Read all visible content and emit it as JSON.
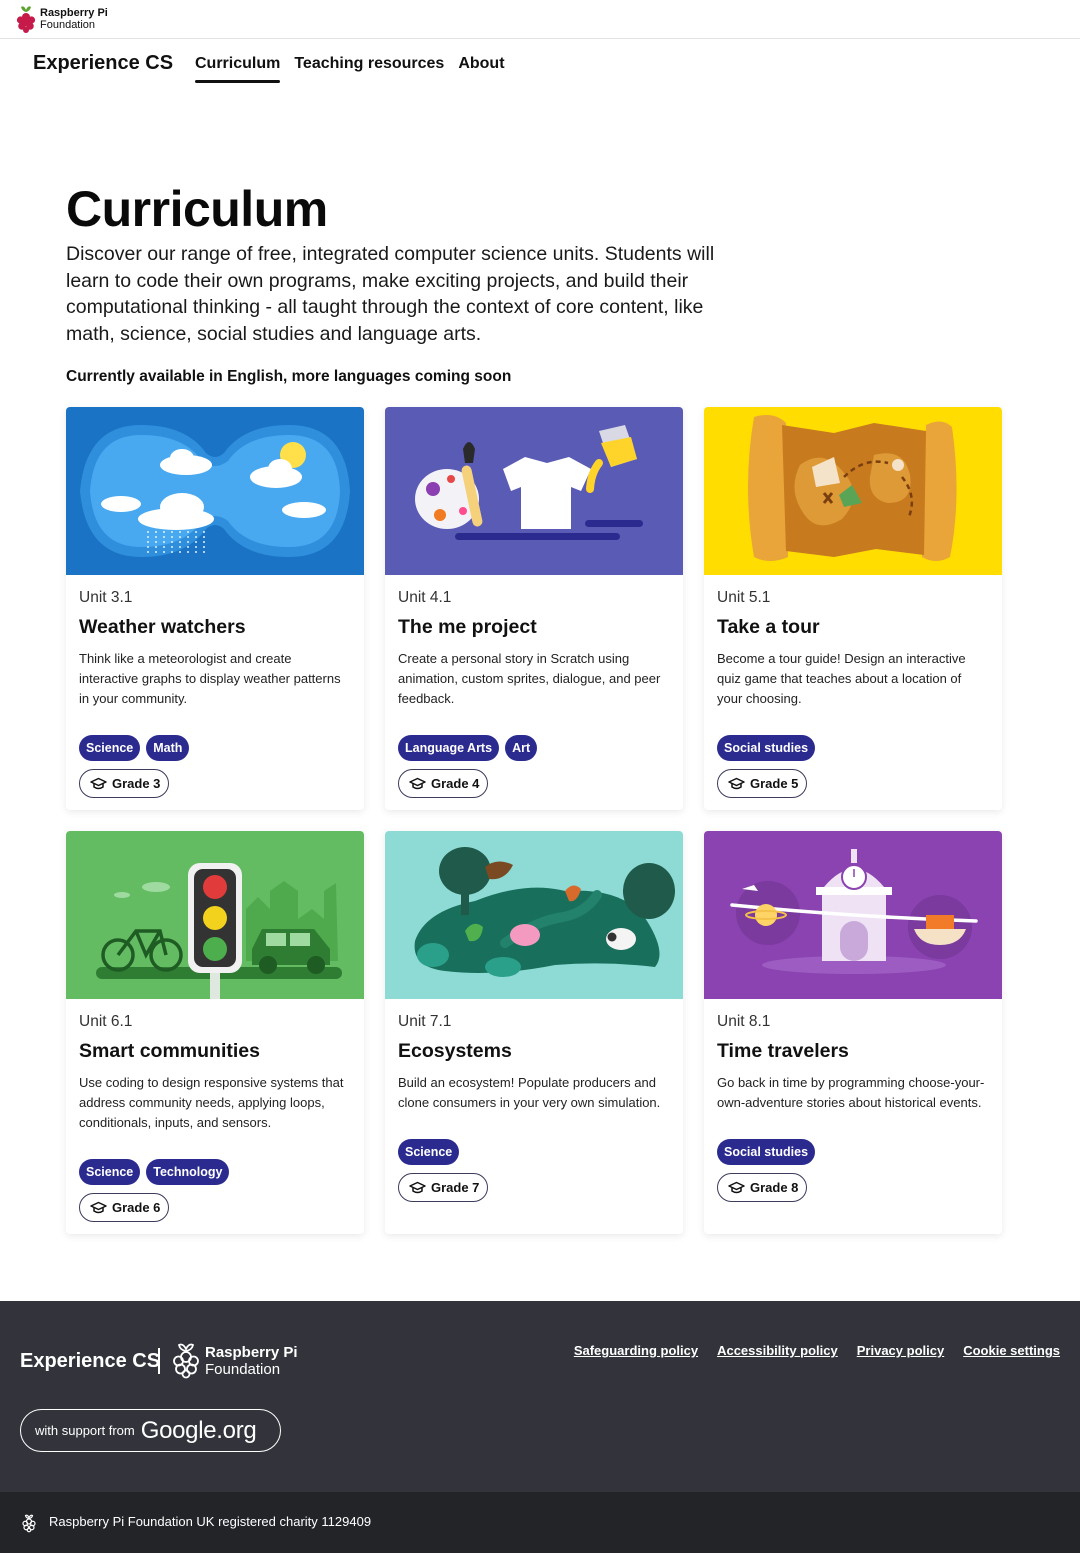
{
  "brand": {
    "org_line1": "Raspberry Pi",
    "org_line2": "Foundation"
  },
  "nav": {
    "site_title": "Experience CS",
    "items": [
      {
        "label": "Curriculum",
        "active": true
      },
      {
        "label": "Teaching resources",
        "active": false
      },
      {
        "label": "About",
        "active": false
      }
    ]
  },
  "hero": {
    "heading": "Curriculum",
    "intro": "Discover our range of free, integrated computer science units. Students will learn to code their own programs, make exciting projects, and build their computational thinking - all taught through the context of core content, like math, science, social studies and language arts.",
    "availability": "Currently available in English, more languages coming soon"
  },
  "cards": [
    {
      "unit": "Unit 3.1",
      "title": "Weather watchers",
      "description": "Think like a meteorologist and create interactive graphs to display weather patterns in your community.",
      "tags": [
        "Science",
        "Math"
      ],
      "grade": "Grade 3",
      "art_color": "#1a73c4"
    },
    {
      "unit": "Unit 4.1",
      "title": "The me project",
      "description": "Create a personal story in Scratch using animation, custom sprites, dialogue, and peer feedback.",
      "tags": [
        "Language Arts",
        "Art"
      ],
      "grade": "Grade 4",
      "art_color": "#5a5bb4"
    },
    {
      "unit": "Unit 5.1",
      "title": "Take a tour",
      "description": "Become a tour guide! Design an interactive quiz game that teaches about a location of your choosing.",
      "tags": [
        "Social studies"
      ],
      "grade": "Grade 5",
      "art_color": "#ffdd00"
    },
    {
      "unit": "Unit 6.1",
      "title": "Smart communities",
      "description": "Use coding to design responsive systems that address community needs, applying loops, conditionals, inputs, and sensors.",
      "tags": [
        "Science",
        "Technology"
      ],
      "grade": "Grade 6",
      "art_color": "#64bc62"
    },
    {
      "unit": "Unit 7.1",
      "title": "Ecosystems",
      "description": "Build an ecosystem! Populate producers and clone consumers in your very own simulation.",
      "tags": [
        "Science"
      ],
      "grade": "Grade 7",
      "art_color": "#8ddbd4"
    },
    {
      "unit": "Unit 8.1",
      "title": "Time travelers",
      "description": "Go back in time by programming choose-your-own-adventure stories about historical events.",
      "tags": [
        "Social studies"
      ],
      "grade": "Grade 8",
      "art_color": "#8a43b0"
    }
  ],
  "footer": {
    "title": "Experience CS",
    "org_line1": "Raspberry Pi",
    "org_line2": "Foundation",
    "links": [
      "Safeguarding policy",
      "Accessibility policy",
      "Privacy policy",
      "Cookie settings"
    ],
    "support_prefix": "with support from",
    "support_brand": "Google.org",
    "charity": "Raspberry Pi Foundation UK registered charity 1129409"
  },
  "colors": {
    "tag_bg": "#2b2a8f",
    "footer_bg": "#33343b",
    "bottombar_bg": "#232428"
  }
}
